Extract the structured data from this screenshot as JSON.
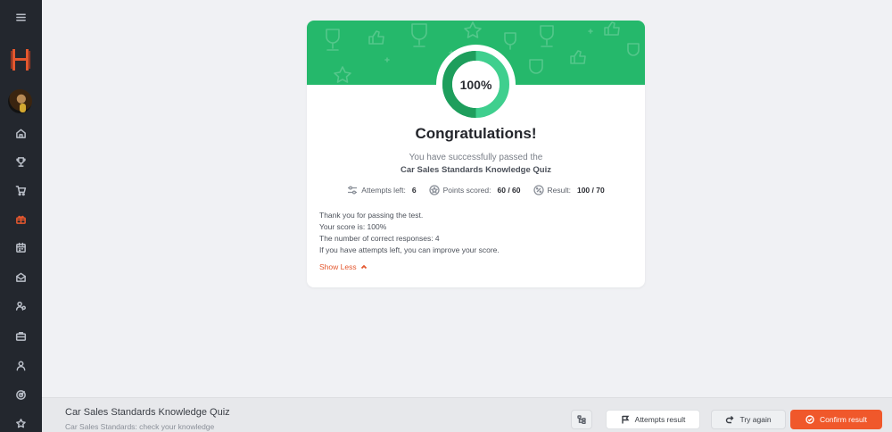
{
  "quiz": {
    "score_percent": 100,
    "score_label": "100%",
    "title": "Congratulations!",
    "subtitle_line1": "You have successfully passed the",
    "subtitle_line2": "Car Sales Standards Knowledge Quiz"
  },
  "stats": {
    "attempts_label": "Attempts left:",
    "attempts_value": "6",
    "points_label": "Points scored:",
    "points_value": "60 / 60",
    "result_label": "Result:",
    "result_value": "100 / 70"
  },
  "details": {
    "line1": "Thank you for passing the test.",
    "line2": "Your score is: 100%",
    "line3": "The number of correct responses: 4",
    "line4": "If you have attempts left, you can improve your score.",
    "toggle_label": "Show Less"
  },
  "footer": {
    "title": "Car Sales Standards Knowledge Quiz",
    "subtitle": "Car Sales Standards: check your knowledge",
    "attempts_button": "Attempts result",
    "try_again_button": "Try again",
    "confirm_button": "Confirm result"
  },
  "colors": {
    "banner": "#25b86b",
    "ring_dark": "#1e9e5c",
    "ring_light": "#3fcf8e",
    "accent": "#f0582b",
    "sidebar": "#23272e"
  },
  "sidebar": {
    "icons": [
      "menu-icon",
      "logo",
      "avatar",
      "home-icon",
      "trophy-icon",
      "cart-icon",
      "gift-icon",
      "calendar-icon",
      "mail-icon",
      "users-icon",
      "briefcase-icon",
      "user-icon",
      "target-icon",
      "star-icon"
    ],
    "active": "gift-icon"
  }
}
